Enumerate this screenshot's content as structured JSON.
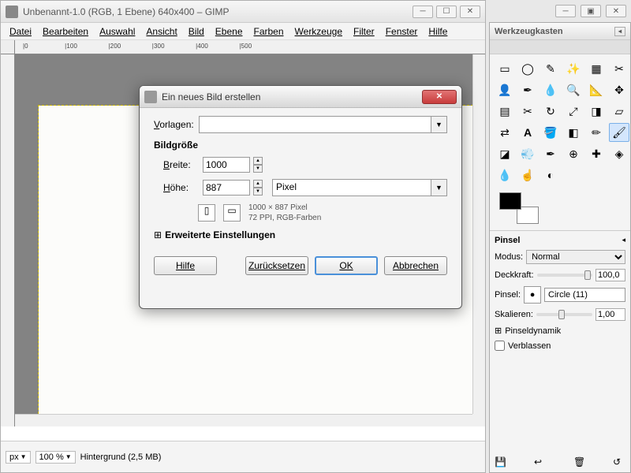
{
  "window": {
    "title": "Unbenannt-1.0 (RGB, 1 Ebene) 640x400 – GIMP"
  },
  "menu": {
    "datei": "Datei",
    "bearbeiten": "Bearbeiten",
    "auswahl": "Auswahl",
    "ansicht": "Ansicht",
    "bild": "Bild",
    "ebene": "Ebene",
    "farben": "Farben",
    "werkzeuge": "Werkzeuge",
    "filter": "Filter",
    "fenster": "Fenster",
    "hilfe": "Hilfe"
  },
  "statusbar": {
    "unit": "px",
    "zoom": "100 %",
    "layer": "Hintergrund (2,5 MB)"
  },
  "toolbox": {
    "title": "Werkzeugkasten"
  },
  "tool_options": {
    "header": "Pinsel",
    "modus_label": "Modus:",
    "modus_value": "Normal",
    "deckkraft_label": "Deckkraft:",
    "deckkraft_value": "100,0",
    "pinsel_label": "Pinsel:",
    "pinsel_value": "Circle (11)",
    "skalieren_label": "Skalieren:",
    "skalieren_value": "1,00",
    "pinseldynamik": "Pinseldynamik",
    "verblassen": "Verblassen"
  },
  "dialog": {
    "title": "Ein neues Bild erstellen",
    "vorlagen_label": "Vorlagen:",
    "bildgroesse": "Bildgröße",
    "breite_label": "Breite:",
    "breite_value": "1000",
    "hoehe_label": "Höhe:",
    "hoehe_value": "887",
    "unit_value": "Pixel",
    "info_line1": "1000 × 887 Pixel",
    "info_line2": "72 PPI, RGB-Farben",
    "erweitert": "Erweiterte Einstellungen",
    "hilfe": "Hilfe",
    "zuruecksetzen": "Zurücksetzen",
    "ok": "OK",
    "abbrechen": "Abbrechen"
  }
}
